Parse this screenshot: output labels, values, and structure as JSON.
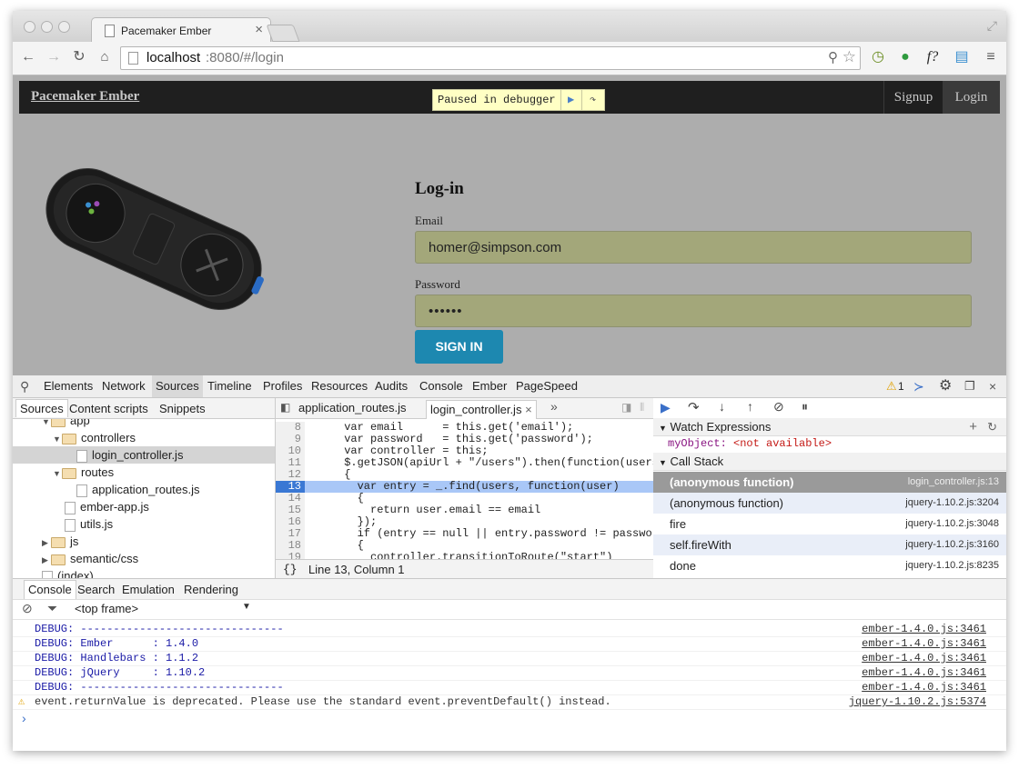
{
  "browser": {
    "tab_title": "Pacemaker Ember",
    "url_host": "localhost",
    "url_rest": ":8080/#/login"
  },
  "page": {
    "brand": "Pacemaker Ember",
    "paused_text": "Paused in debugger",
    "nav": [
      "Signup",
      "Login"
    ],
    "heading": "Log-in",
    "email_label": "Email",
    "email_value": "homer@simpson.com",
    "password_label": "Password",
    "password_value": "••••••",
    "submit_label": "SIGN IN"
  },
  "devtools": {
    "tabs": [
      "Elements",
      "Network",
      "Sources",
      "Timeline",
      "Profiles",
      "Resources",
      "Audits",
      "Console",
      "Ember",
      "PageSpeed"
    ],
    "active_tab": "Sources",
    "warning_count": "1",
    "navigator_tabs": [
      "Sources",
      "Content scripts",
      "Snippets"
    ],
    "tree": [
      "app",
      "controllers",
      "login_controller.js",
      "routes",
      "application_routes.js",
      "ember-app.js",
      "utils.js",
      "js",
      "semantic/css",
      "(index)"
    ],
    "editor_tabs": [
      "application_routes.js",
      "login_controller.js"
    ],
    "code": [
      {
        "n": "8",
        "t": "      var email      = this.get('email');"
      },
      {
        "n": "9",
        "t": "      var password   = this.get('password');"
      },
      {
        "n": "10",
        "t": "      var controller = this;"
      },
      {
        "n": "11",
        "t": "      $.getJSON(apiUrl + \"/users\").then(function(users"
      },
      {
        "n": "12",
        "t": "      {"
      },
      {
        "n": "13",
        "t": "        var entry = _.find(users, function(user)"
      },
      {
        "n": "14",
        "t": "        {"
      },
      {
        "n": "15",
        "t": "          return user.email == email"
      },
      {
        "n": "16",
        "t": "        });"
      },
      {
        "n": "17",
        "t": "        if (entry == null || entry.password != passwor"
      },
      {
        "n": "18",
        "t": "        {"
      },
      {
        "n": "19",
        "t": "          controller.transitionToRoute(\"start\")"
      }
    ],
    "status": "Line 13, Column 1",
    "watch_title": "Watch Expressions",
    "watch_name": "myObject",
    "watch_value": "<not available>",
    "callstack_title": "Call Stack",
    "callstack": [
      {
        "fn": "(anonymous function)",
        "file": "login_controller.js:13"
      },
      {
        "fn": "(anonymous function)",
        "file": "jquery-1.10.2.js:3204"
      },
      {
        "fn": "fire",
        "file": "jquery-1.10.2.js:3048"
      },
      {
        "fn": "self.fireWith",
        "file": "jquery-1.10.2.js:3160"
      },
      {
        "fn": "done",
        "file": "jquery-1.10.2.js:8235"
      }
    ],
    "console_tabs": [
      "Console",
      "Search",
      "Emulation",
      "Rendering"
    ],
    "frame": "<top frame>",
    "console_lines": [
      {
        "msg": "DEBUG: -------------------------------",
        "src": "ember-1.4.0.js:3461"
      },
      {
        "msg": "DEBUG: Ember      : 1.4.0",
        "src": "ember-1.4.0.js:3461"
      },
      {
        "msg": "DEBUG: Handlebars : 1.1.2",
        "src": "ember-1.4.0.js:3461"
      },
      {
        "msg": "DEBUG: jQuery     : 1.10.2",
        "src": "ember-1.4.0.js:3461"
      },
      {
        "msg": "DEBUG: -------------------------------",
        "src": "ember-1.4.0.js:3461"
      },
      {
        "msg": "event.returnValue is deprecated. Please use the standard event.preventDefault() instead.",
        "src": "jquery-1.10.2.js:5374"
      }
    ],
    "prompt": "›"
  }
}
